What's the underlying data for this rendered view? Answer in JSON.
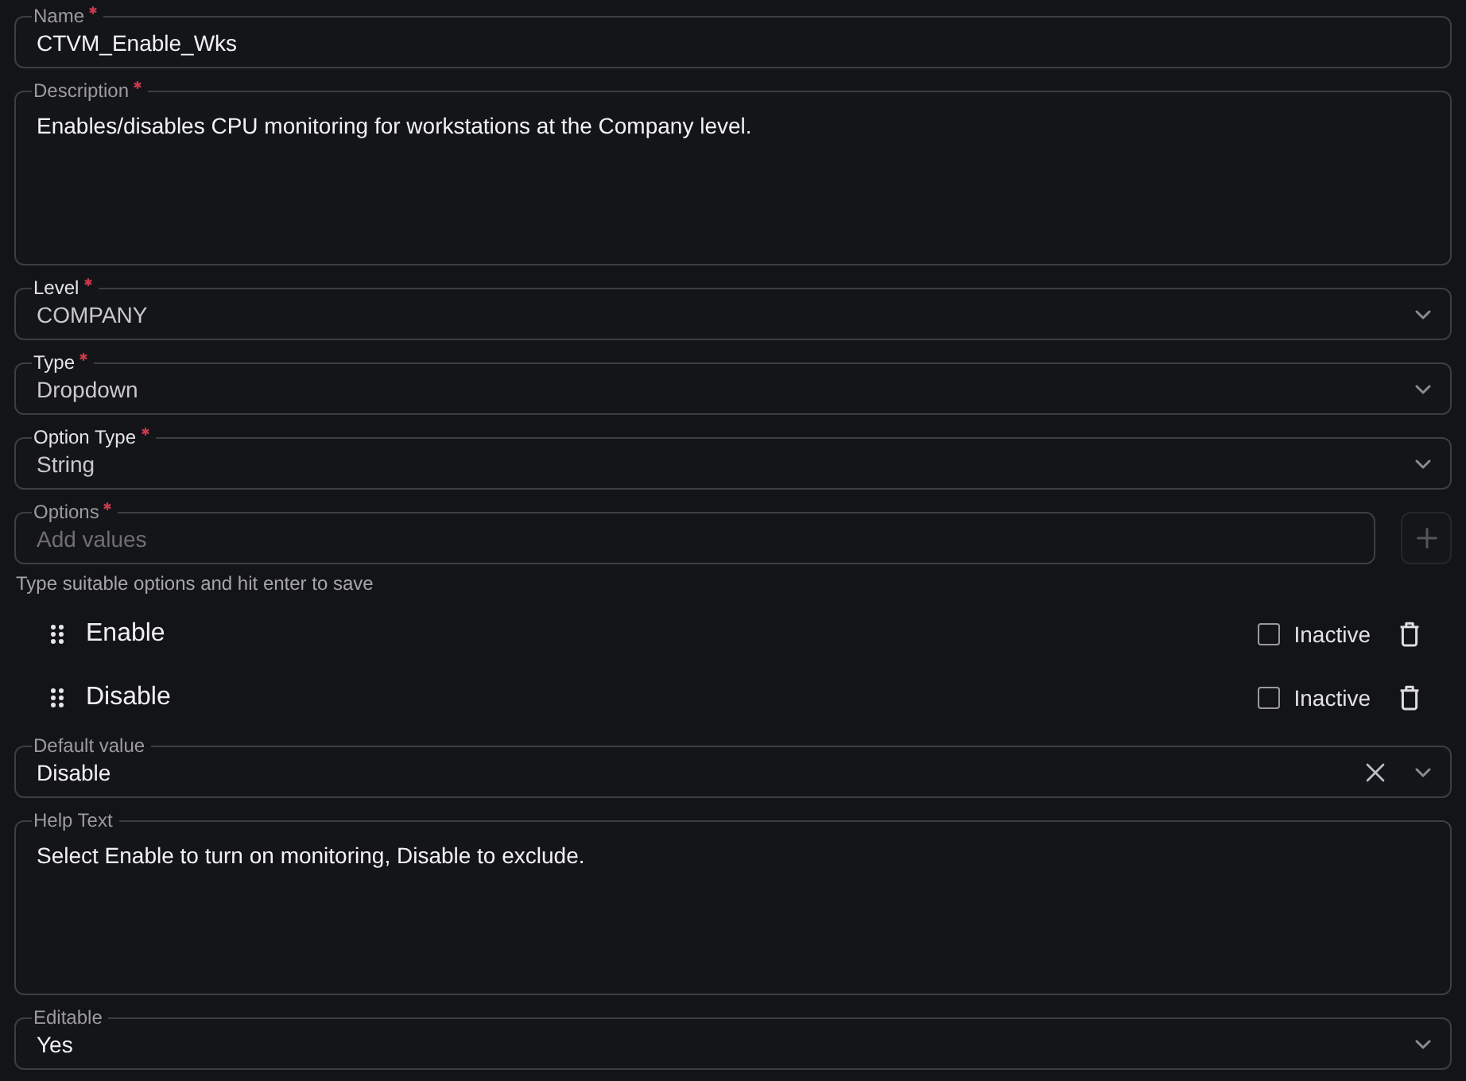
{
  "form": [
    {
      "kind": "text",
      "label": "Name",
      "required": true,
      "disabled": false,
      "value": "CTVM_Enable_Wks"
    },
    {
      "kind": "textarea",
      "label": "Description",
      "required": true,
      "disabled": false,
      "value": "Enables/disables CPU monitoring for workstations at the Company level."
    },
    {
      "kind": "select",
      "label": "Level",
      "required": true,
      "disabled": true,
      "clearable": false,
      "value": "COMPANY"
    },
    {
      "kind": "select",
      "label": "Type",
      "required": true,
      "disabled": true,
      "clearable": false,
      "value": "Dropdown"
    },
    {
      "kind": "select",
      "label": "Option Type",
      "required": true,
      "disabled": true,
      "clearable": false,
      "value": "String"
    },
    {
      "kind": "options",
      "label": "Options",
      "required": true,
      "disabled": false,
      "placeholder": "Add values",
      "add_button": {
        "disabled": true
      },
      "hint": "Type suitable options and hit enter to save",
      "items": [
        {
          "label": "Enable",
          "checked": false,
          "checkbox_label": "Inactive"
        },
        {
          "label": "Disable",
          "checked": false,
          "checkbox_label": "Inactive"
        }
      ]
    },
    {
      "kind": "select",
      "label": "Default value",
      "required": false,
      "disabled": false,
      "clearable": true,
      "value": "Disable"
    },
    {
      "kind": "textarea",
      "label": "Help Text",
      "required": false,
      "disabled": false,
      "value": "Select Enable to turn on monitoring, Disable to exclude."
    },
    {
      "kind": "select",
      "label": "Editable",
      "required": false,
      "disabled": false,
      "clearable": false,
      "value": "Yes"
    }
  ]
}
